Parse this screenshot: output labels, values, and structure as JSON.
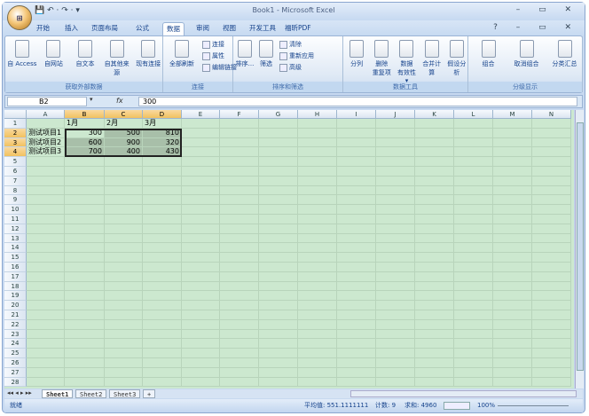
{
  "window": {
    "title": "Book1 - Microsoft Excel",
    "office_button": "Office",
    "qat": "💾 ↶ · ↷ · ▾",
    "controls": "– ▭ ✕",
    "ribbon_controls": "? – ▭ ✕"
  },
  "tabs": [
    "开始",
    "插入",
    "页面布局",
    "公式",
    "数据",
    "审阅",
    "视图",
    "开发工具",
    "福昕PDF"
  ],
  "active_tab": "数据",
  "ribbon": {
    "groups": [
      {
        "label": "获取外部数据",
        "buttons": [
          "自 Access",
          "自网站",
          "自文本",
          "自其他来源",
          "现有连接"
        ]
      },
      {
        "label": "连接",
        "buttons": [
          "全部刷新"
        ],
        "small": [
          "连接",
          "属性",
          "编辑链接"
        ]
      },
      {
        "label": "排序和筛选",
        "buttons": [
          "排序...",
          "筛选"
        ],
        "small": [
          "清除",
          "重新应用",
          "高级"
        ]
      },
      {
        "label": "数据工具",
        "buttons": [
          "分列",
          "删除\n重复项",
          "数据\n有效性 ▾",
          "合并计算",
          "假设分析"
        ]
      },
      {
        "label": "分级显示",
        "buttons": [
          "组合",
          "取消组合",
          "分类汇总"
        ]
      }
    ]
  },
  "formula_bar": {
    "name_box": "B2",
    "fx": "fx",
    "value": "300"
  },
  "columns": [
    "A",
    "B",
    "C",
    "D",
    "E",
    "F",
    "G",
    "H",
    "I",
    "J",
    "K",
    "L",
    "M",
    "N"
  ],
  "selected_columns": [
    "B",
    "C",
    "D"
  ],
  "rows": 28,
  "selected_rows": [
    2,
    3,
    4
  ],
  "cells": {
    "B1": "1月",
    "C1": "2月",
    "D1": "3月",
    "A2": "测试项目1",
    "B2": "300",
    "C2": "500",
    "D2": "810",
    "A3": "测试项目2",
    "B3": "600",
    "C3": "900",
    "D3": "320",
    "A4": "测试项目3",
    "B4": "700",
    "C4": "400",
    "D4": "430"
  },
  "sheets": [
    "Sheet1",
    "Sheet2",
    "Sheet3"
  ],
  "active_sheet": "Sheet1",
  "status": {
    "mode": "就绪",
    "average": "平均值: 551.1111111",
    "count": "计数: 9",
    "sum": "求和: 4960",
    "zoom": "100%"
  }
}
